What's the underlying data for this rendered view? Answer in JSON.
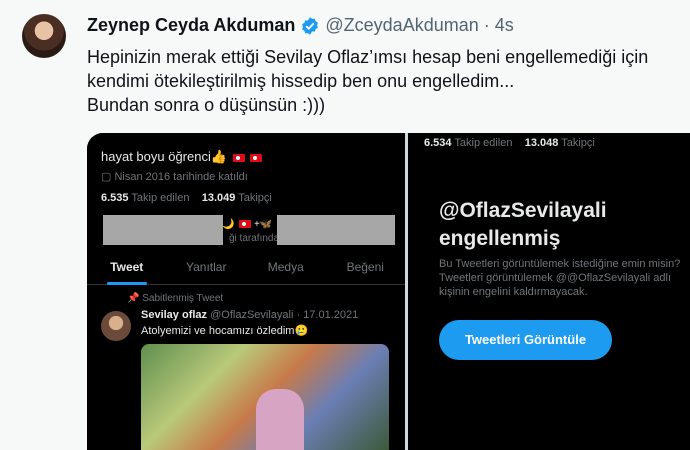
{
  "tweet": {
    "display_name": "Zeynep Ceyda Akduman",
    "handle": "@ZceydaAkduman",
    "separator": "·",
    "time": "4s",
    "lines": [
      "Hepinizin merak ettiği Sevilay Oflaz’ımsı hesap beni engellemediği için",
      "kendimi ötekileştirilmiş hissedip ben onu engelledim...",
      "Bundan sonra o düşünsün :)))"
    ]
  },
  "left_panel": {
    "bio": "hayat boyu öğrenci👍",
    "joined": "Nisan 2016 tarihinde katıldı",
    "following_count": "6.535",
    "following_label": "Takip edilen",
    "followers_count": "13.049",
    "followers_label": "Takipçi",
    "followed_by_text": "ği tarafında",
    "tabs": [
      "Tweet",
      "Yanıtlar",
      "Medya",
      "Beğeni"
    ],
    "pinned_label": "Sabitlenmiş Tweet",
    "post_name": "Sevilay oflaz",
    "post_handle_date": "@OflazSevilayali · 17.01.2021",
    "post_text": "Atolyemizi ve hocamızı özledim🥲"
  },
  "right_panel": {
    "following_count": "6.534",
    "following_label": "Takip edilen",
    "followers_count": "13.048",
    "followers_label": "Takipçi",
    "title_line1": "@OflazSevilayali",
    "title_line2": "engellenmiş",
    "desc_lines": [
      "Bu Tweetleri görüntülemek istediğine emin misin?",
      "Tweetleri görüntülemek @@OflazSevilayali adlı",
      "kişinin engelini kaldırmayacak."
    ],
    "button_label": "Tweetleri Görüntüle"
  },
  "colors": {
    "accent": "#1d9bf0",
    "background": "#f7f9f9",
    "dark_bg": "#000000"
  }
}
